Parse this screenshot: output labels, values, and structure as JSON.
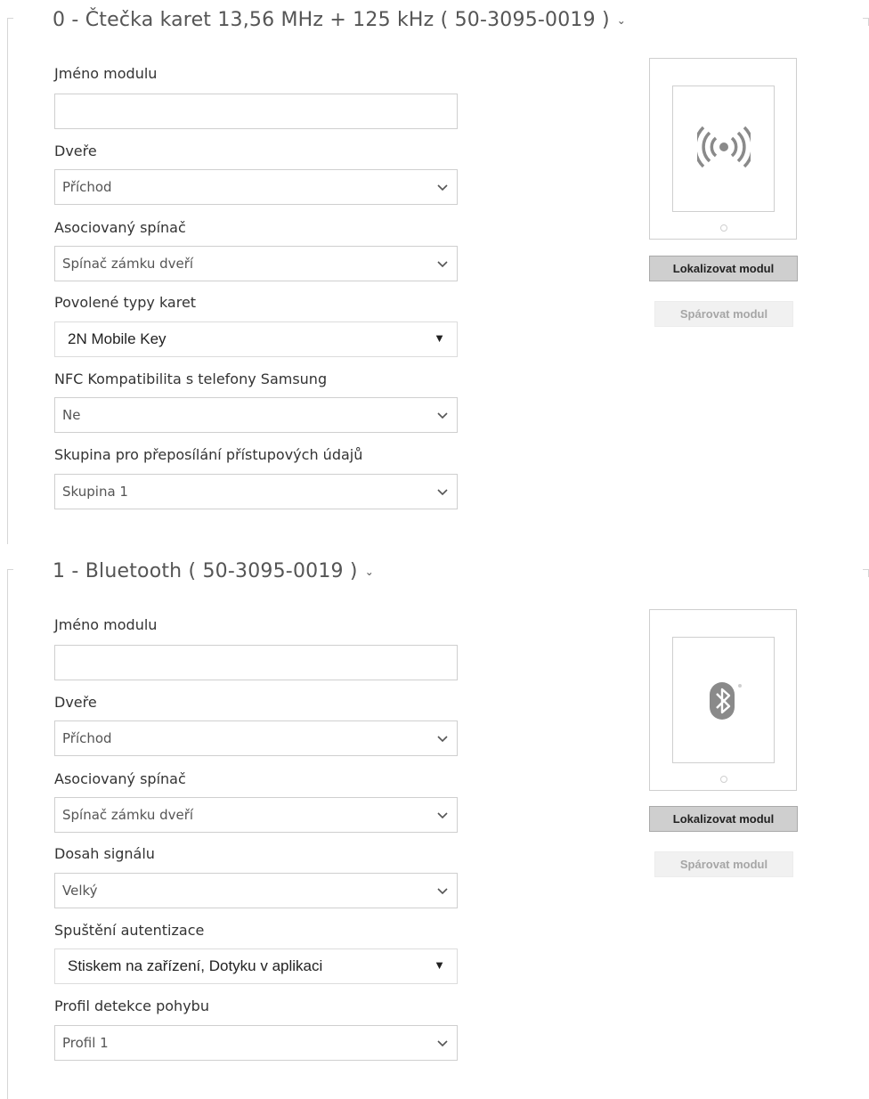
{
  "modules": [
    {
      "title": "0 - Čtečka karet 13,56 MHz + 125 kHz ( 50-3095-0019 )",
      "fields": [
        {
          "label": "Jméno modulu",
          "value": ""
        },
        {
          "label": "Dveře",
          "value": "Příchod"
        },
        {
          "label": "Asociovaný spínač",
          "value": "Spínač zámku dveří"
        },
        {
          "label": "Povolené typy karet",
          "value": "2N Mobile Key"
        },
        {
          "label": "NFC Kompatibilita s telefony Samsung",
          "value": "Ne"
        },
        {
          "label": "Skupina pro přeposílání přístupových údajů",
          "value": "Skupina 1"
        }
      ],
      "icon": "rfid-wave-icon",
      "locate_label": "Lokalizovat modul",
      "pair_label": "Spárovat modul"
    },
    {
      "title": "1 - Bluetooth ( 50-3095-0019 )",
      "fields": [
        {
          "label": "Jméno modulu",
          "value": ""
        },
        {
          "label": "Dveře",
          "value": "Příchod"
        },
        {
          "label": "Asociovaný spínač",
          "value": "Spínač zámku dveří"
        },
        {
          "label": "Dosah signálu",
          "value": "Velký"
        },
        {
          "label": "Spuštění autentizace",
          "value": "Stiskem na zařízení, Dotyku v aplikaci"
        },
        {
          "label": "Profil detekce pohybu",
          "value": "Profil 1"
        }
      ],
      "icon": "bluetooth-icon",
      "locate_label": "Lokalizovat modul",
      "pair_label": "Spárovat modul"
    }
  ]
}
